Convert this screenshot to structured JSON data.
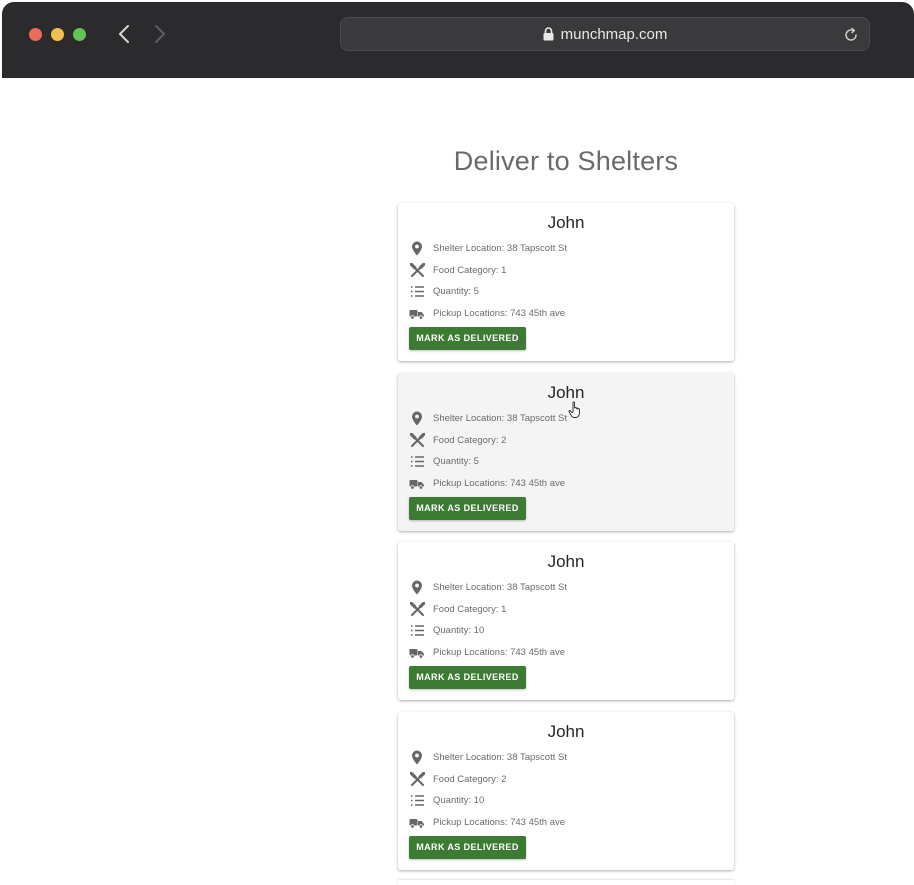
{
  "browser": {
    "url": "munchmap.com"
  },
  "page": {
    "title": "Deliver to Shelters"
  },
  "cards": [
    {
      "name": "John",
      "shelter_location": "Shelter Location: 38 Tapscott St",
      "food_category": "Food Category: 1",
      "quantity": "Quantity: 5",
      "pickup_locations": "Pickup Locations: 743 45th ave",
      "button": "MARK AS DELIVERED"
    },
    {
      "name": "John",
      "shelter_location": "Shelter Location: 38 Tapscott St",
      "food_category": "Food Category: 2",
      "quantity": "Quantity: 5",
      "pickup_locations": "Pickup Locations: 743 45th ave",
      "button": "MARK AS DELIVERED"
    },
    {
      "name": "John",
      "shelter_location": "Shelter Location: 38 Tapscott St",
      "food_category": "Food Category: 1",
      "quantity": "Quantity: 10",
      "pickup_locations": "Pickup Locations: 743 45th ave",
      "button": "MARK AS DELIVERED"
    },
    {
      "name": "John",
      "shelter_location": "Shelter Location: 38 Tapscott St",
      "food_category": "Food Category: 2",
      "quantity": "Quantity: 10",
      "pickup_locations": "Pickup Locations: 743 45th ave",
      "button": "MARK AS DELIVERED"
    }
  ],
  "icons": {
    "shelter": "location-pin-icon",
    "food": "utensils-icon",
    "quantity": "list-icon",
    "pickup": "delivery-truck-icon"
  },
  "colors": {
    "button": "#3d7a34",
    "titlebar": "#2b2b2d",
    "hover_card": "#f4f4f4"
  }
}
